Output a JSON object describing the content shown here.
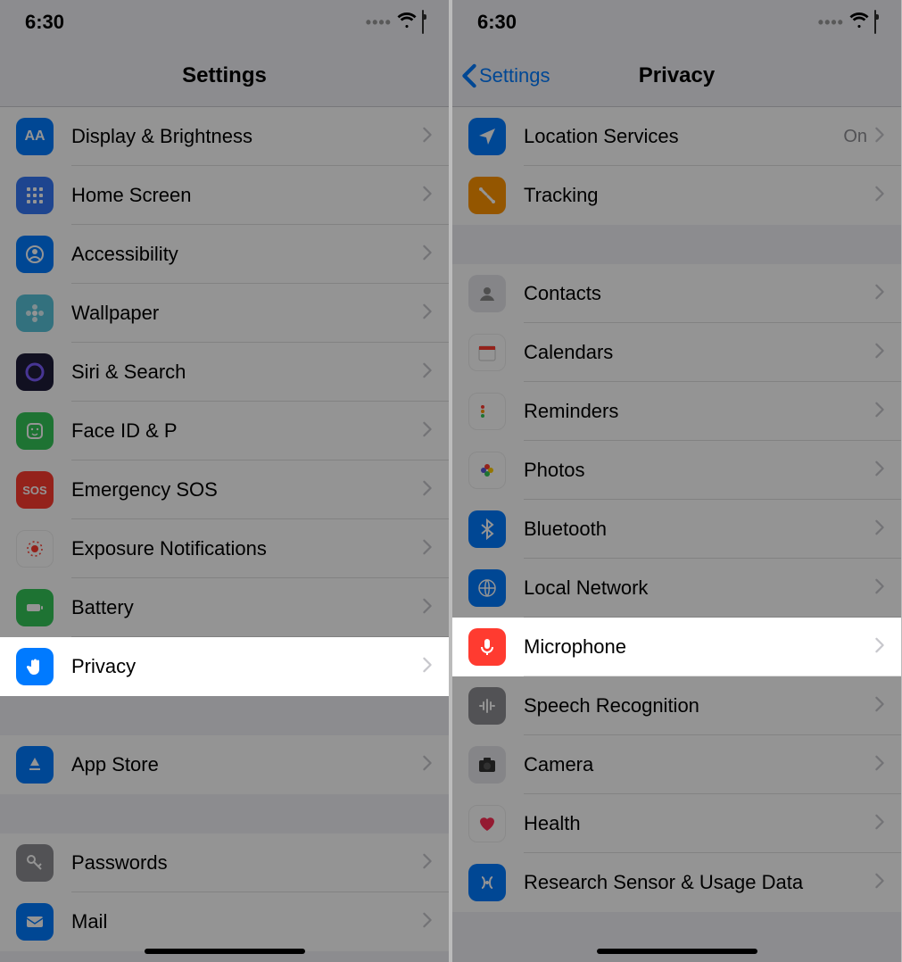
{
  "left": {
    "status_time": "6:30",
    "title": "Settings",
    "highlight_key": "privacy",
    "groups": [
      [
        {
          "key": "display",
          "label": "Display & Brightness",
          "icon": "aa",
          "bg": "bg-blue"
        },
        {
          "key": "home",
          "label": "Home Screen",
          "icon": "grid",
          "bg": "bg-indigo"
        },
        {
          "key": "accessibility",
          "label": "Accessibility",
          "icon": "person-circle",
          "bg": "bg-blue"
        },
        {
          "key": "wallpaper",
          "label": "Wallpaper",
          "icon": "flower",
          "bg": "bg-teal"
        },
        {
          "key": "siri",
          "label": "Siri & Search",
          "icon": "siri",
          "bg": "bg-purple"
        },
        {
          "key": "faceid",
          "label": "Face ID & P",
          "icon": "face",
          "bg": "bg-green"
        },
        {
          "key": "sos",
          "label": "Emergency SOS",
          "icon": "sos",
          "bg": "bg-red"
        },
        {
          "key": "exposure",
          "label": "Exposure Notifications",
          "icon": "exposure",
          "bg": "bg-white"
        },
        {
          "key": "battery",
          "label": "Battery",
          "icon": "battery",
          "bg": "bg-green"
        },
        {
          "key": "privacy",
          "label": "Privacy",
          "icon": "hand",
          "bg": "bg-blue"
        }
      ],
      [
        {
          "key": "appstore",
          "label": "App Store",
          "icon": "appstore",
          "bg": "bg-blue"
        }
      ],
      [
        {
          "key": "passwords",
          "label": "Passwords",
          "icon": "key",
          "bg": "bg-gray"
        },
        {
          "key": "mail",
          "label": "Mail",
          "icon": "mail",
          "bg": "bg-blue"
        }
      ]
    ]
  },
  "right": {
    "status_time": "6:30",
    "back_label": "Settings",
    "title": "Privacy",
    "highlight_key": "microphone",
    "groups": [
      [
        {
          "key": "location",
          "label": "Location Services",
          "icon": "location",
          "bg": "bg-blue",
          "value": "On"
        },
        {
          "key": "tracking",
          "label": "Tracking",
          "icon": "tracking",
          "bg": "bg-yellow"
        }
      ],
      [
        {
          "key": "contacts",
          "label": "Contacts",
          "icon": "contacts",
          "bg": "bg-lightgray"
        },
        {
          "key": "calendars",
          "label": "Calendars",
          "icon": "calendar",
          "bg": "bg-white"
        },
        {
          "key": "reminders",
          "label": "Reminders",
          "icon": "reminders",
          "bg": "bg-white"
        },
        {
          "key": "photos",
          "label": "Photos",
          "icon": "photos",
          "bg": "bg-white"
        },
        {
          "key": "bluetooth",
          "label": "Bluetooth",
          "icon": "bluetooth",
          "bg": "bg-blue"
        },
        {
          "key": "localnet",
          "label": "Local Network",
          "icon": "globe",
          "bg": "bg-blue"
        },
        {
          "key": "microphone",
          "label": "Microphone",
          "icon": "mic",
          "bg": "bg-red"
        },
        {
          "key": "speech",
          "label": "Speech Recognition",
          "icon": "wave",
          "bg": "bg-gray"
        },
        {
          "key": "camera",
          "label": "Camera",
          "icon": "camera",
          "bg": "bg-lightgray"
        },
        {
          "key": "health",
          "label": "Health",
          "icon": "heart",
          "bg": "bg-white"
        },
        {
          "key": "research",
          "label": "Research Sensor & Usage Data",
          "icon": "sensor",
          "bg": "bg-blue"
        }
      ]
    ]
  }
}
